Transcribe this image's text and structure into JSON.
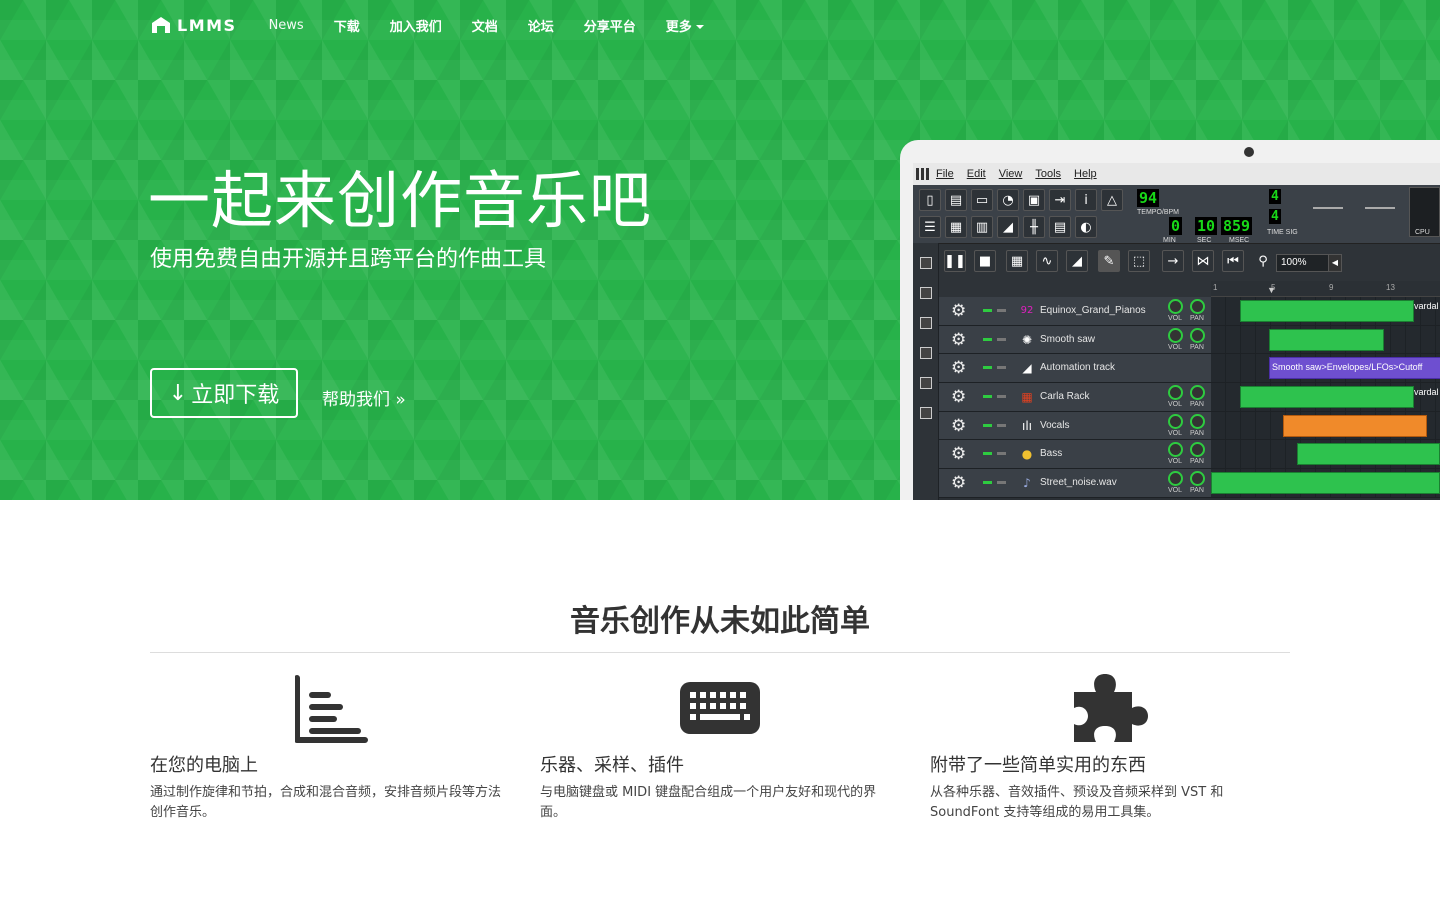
{
  "nav": {
    "logo_text": "LMMS",
    "items": [
      "News",
      "下载",
      "加入我们",
      "文档",
      "论坛",
      "分享平台",
      "更多"
    ]
  },
  "hero": {
    "title": "一起来创作音乐吧",
    "subtitle": "使用免费自由开源并且跨平台的作曲工具",
    "download_label": "立即下载",
    "help_label": "帮助我们 »"
  },
  "app": {
    "menu": [
      "File",
      "Edit",
      "View",
      "Tools",
      "Help"
    ],
    "tempo": "94",
    "tempo_label": "TEMPO/BPM",
    "time_min": "0",
    "time_sec": "10",
    "time_msec": "859",
    "min_label": "MIN",
    "sec_label": "SEC",
    "msec_label": "MSEC",
    "timesig_top": "4",
    "timesig_bottom": "4",
    "timesig_label": "TIME SIG",
    "cpu_label": "CPU",
    "zoom": "100%",
    "ruler": [
      "1",
      "5",
      "9",
      "13"
    ],
    "vol_label": "VOL",
    "pan_label": "PAN",
    "tracks": [
      {
        "name": "Equinox_Grand_Pianos",
        "icon": "92"
      },
      {
        "name": "Smooth saw",
        "icon": "creature-icon"
      },
      {
        "name": "Automation track",
        "icon": "automation-icon"
      },
      {
        "name": "Carla Rack",
        "icon": "carla-icon"
      },
      {
        "name": "Vocals",
        "icon": "waveform-icon"
      },
      {
        "name": "Bass",
        "icon": "fruit-icon"
      },
      {
        "name": "Street_noise.wav",
        "icon": "note-icon"
      }
    ],
    "automation_clip": "Smooth saw>Envelopes/LFOs>Cutoff",
    "clip_label": "vardal"
  },
  "features": {
    "title": "音乐创作从未如此简单",
    "items": [
      {
        "icon": "bar-chart-icon",
        "title": "在您的电脑上",
        "text": "通过制作旋律和节拍，合成和混合音频，安排音频片段等方法创作音乐。"
      },
      {
        "icon": "keyboard-icon",
        "title": "乐器、采样、插件",
        "text": "与电脑键盘或 MIDI 键盘配合组成一个用户友好和现代的界面。"
      },
      {
        "icon": "puzzle-icon",
        "title": "附带了一些简单实用的东西",
        "text": "从各种乐器、音效插件、预设及音频采样到 VST 和 SoundFont 支持等组成的易用工具集。"
      }
    ]
  },
  "colors": {
    "brand_green": "#27b24a",
    "clip_green": "#2ec24e",
    "automation_purple": "#6e4fd0",
    "sample_orange": "#f08a2a"
  }
}
